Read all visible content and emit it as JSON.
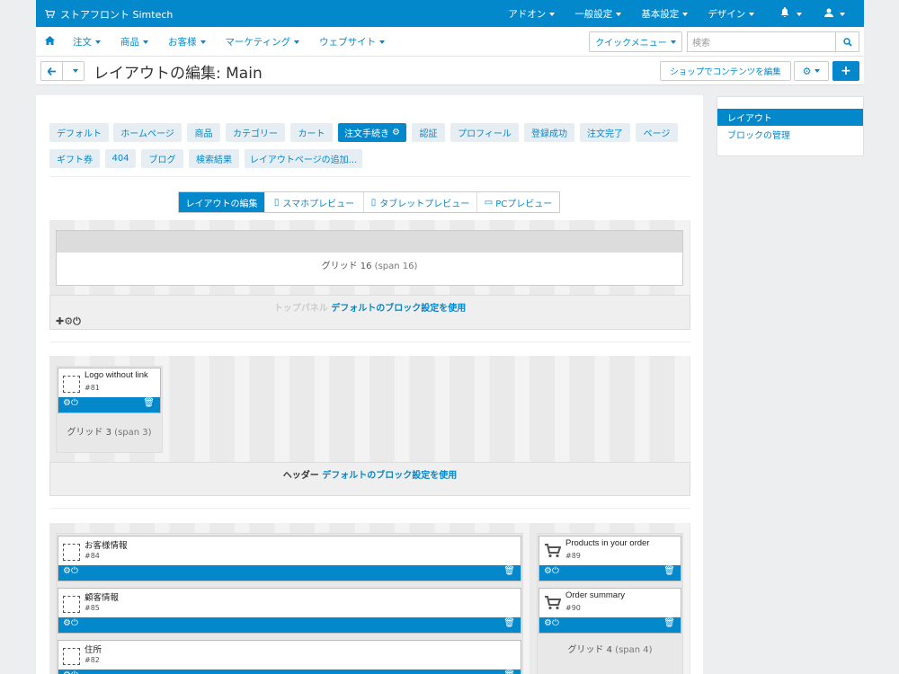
{
  "topbar": {
    "brand": "ストアフロント Simtech",
    "menu": [
      "アドオン",
      "一般設定",
      "基本設定",
      "デザイン"
    ]
  },
  "navbar": {
    "items": [
      "注文",
      "商品",
      "お客様",
      "マーケティング",
      "ウェブサイト"
    ],
    "quick_menu": "クイックメニュー",
    "search_placeholder": "検索"
  },
  "titlebar": {
    "title": "レイアウトの編集: Main",
    "edit_content_button": "ショップでコンテンツを編集"
  },
  "sidebar": {
    "items": [
      "レイアウト",
      "ブロックの管理"
    ]
  },
  "layout_tabs": [
    "デフォルト",
    "ホームページ",
    "商品",
    "カテゴリー",
    "カート",
    "注文手続き",
    "認証",
    "プロフィール",
    "登録成功",
    "注文完了",
    "ページ",
    "ギフト券",
    "404",
    "ブログ",
    "検索結果",
    "レイアウトページの追加..."
  ],
  "active_tab": "注文手続き",
  "preview": {
    "tabs": [
      "レイアウトの編集",
      "スマホプレビュー",
      "タブレットプレビュー",
      "PCプレビュー"
    ]
  },
  "top_panel": {
    "grid_label": "グリッド 16",
    "grid_span": "(span 16)",
    "container_name": "トップパネル",
    "container_link": "デフォルトのブロック設定を使用"
  },
  "header": {
    "block": {
      "name": "Logo without link",
      "id": "#81"
    },
    "grid_label": "グリッド 3",
    "grid_span": "(span 3)",
    "container_name": "ヘッダー",
    "container_link": "デフォルトのブロック設定を使用"
  },
  "content": {
    "left_blocks": [
      {
        "name": "お客様情報",
        "id": "#84"
      },
      {
        "name": "顧客情報",
        "id": "#85"
      },
      {
        "name": "住所",
        "id": "#82"
      }
    ],
    "right_blocks": [
      {
        "name": "Products in your order",
        "id": "#89"
      },
      {
        "name": "Order summary",
        "id": "#90"
      }
    ],
    "right_grid_label": "グリッド 4",
    "right_grid_span": "(span 4)"
  },
  "colors": {
    "accent": "#0388cc"
  }
}
